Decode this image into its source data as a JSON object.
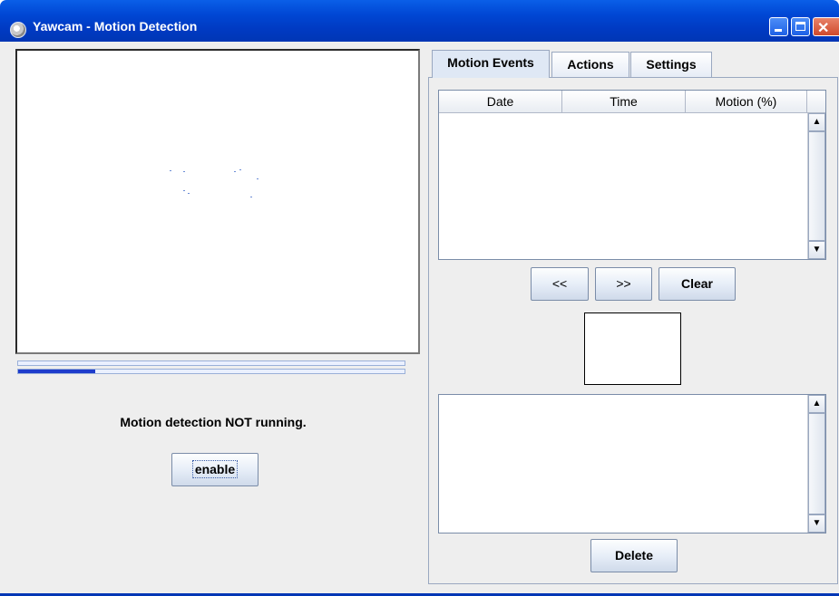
{
  "window": {
    "title": "Yawcam - Motion Detection",
    "icon": "yawcam-app-icon",
    "controls": {
      "minimize": "minimize-icon",
      "maximize": "maximize-icon",
      "close": "✕"
    }
  },
  "left_panel": {
    "status": "Motion detection NOT running.",
    "enable_label": "enable",
    "progress": {
      "top_fraction": 0.0,
      "bottom_fraction": 0.2
    }
  },
  "tabs": [
    {
      "label": "Motion Events",
      "active": true
    },
    {
      "label": "Actions",
      "active": false
    },
    {
      "label": "Settings",
      "active": false
    }
  ],
  "events_table": {
    "columns": [
      "Date",
      "Time",
      "Motion (%)"
    ],
    "rows": []
  },
  "nav": {
    "prev_label": "<<",
    "next_label": ">>",
    "clear_label": "Clear"
  },
  "scroll": {
    "up": "▲",
    "down": "▼"
  },
  "delete_label": "Delete",
  "colors": {
    "titlebar": "#0047d4",
    "panel": "#eeeeee",
    "progress_fill": "#1e3ccc"
  }
}
